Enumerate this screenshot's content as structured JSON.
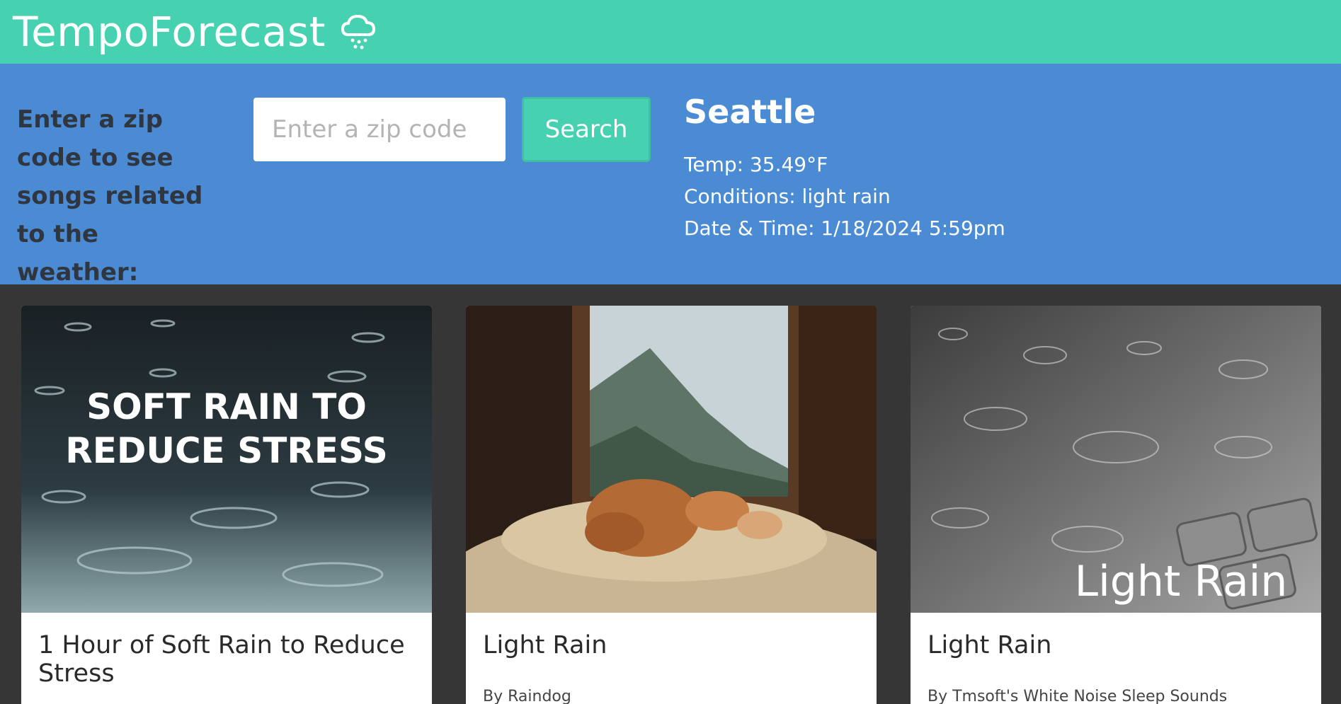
{
  "header": {
    "brand": "TempoForecast",
    "brand_icon": "rain-cloud-icon"
  },
  "search": {
    "prompt": "Enter a zip code to see songs related to the weather:",
    "placeholder": "Enter a zip code",
    "button_label": "Search"
  },
  "weather": {
    "city": "Seattle",
    "temp": "Temp: 35.49°F",
    "conditions": "Conditions: light rain",
    "datetime": "Date & Time: 1/18/2024 5:59pm"
  },
  "songs": [
    {
      "title": "1 Hour of Soft Rain to Reduce Stress",
      "artist": "",
      "art_text_line1": "SOFT RAIN TO",
      "art_text_line2": "REDUCE STRESS"
    },
    {
      "title": "Light Rain",
      "artist": "By  Raindog",
      "art_text_line1": "",
      "art_text_line2": ""
    },
    {
      "title": "Light Rain",
      "artist": "By  Tmsoft's White Noise Sleep Sounds",
      "art_text_line1": "Light Rain",
      "art_text_line2": ""
    }
  ],
  "colors": {
    "header": "#46d1b0",
    "search_band": "#4a8bd4",
    "background": "#363636",
    "button": "#46d1b0"
  }
}
